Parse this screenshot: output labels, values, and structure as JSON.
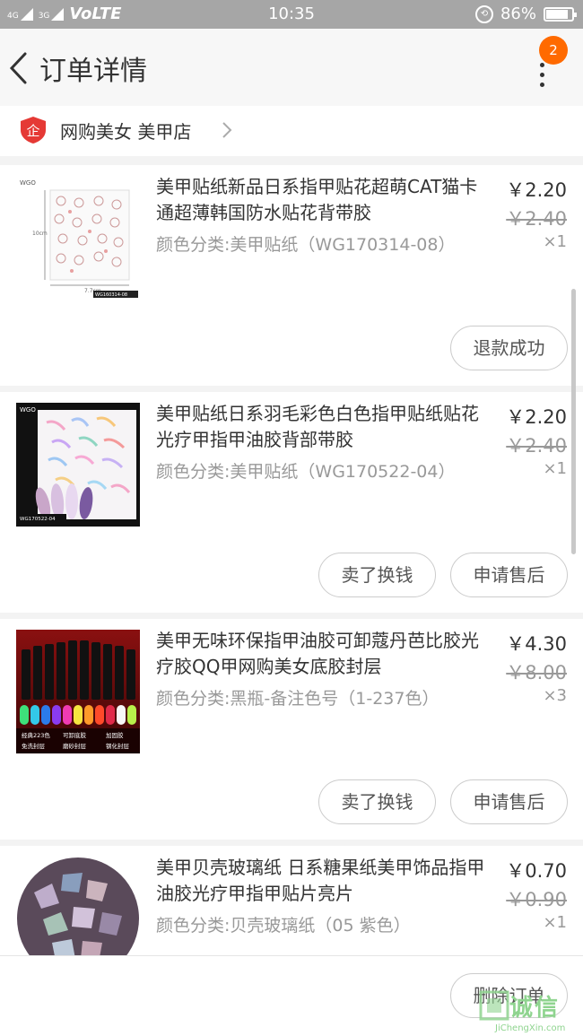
{
  "status_bar": {
    "signal1": "4G",
    "signal2": "3G",
    "network": "VoLTE",
    "time": "10:35",
    "battery": "86%",
    "battery_level": 0.86
  },
  "header": {
    "title": "订单详情",
    "badge_count": "2"
  },
  "shop": {
    "name": "网购美女 美甲店",
    "icon_label": "企"
  },
  "items": [
    {
      "title": "美甲贴纸新品日系指甲贴花超萌CAT猫卡通超薄韩国防水贴花背带胶",
      "sku": "颜色分类:美甲贴纸（WG170314-08）",
      "price": "￥2.20",
      "orig_price": "￥2.40",
      "qty": "×1",
      "thumb_label": "WG160314-08",
      "thumb_height_label": "10cm",
      "thumb_width_label": "7.7cm",
      "thumb_brand": "WGO",
      "buttons": [
        "退款成功"
      ]
    },
    {
      "title": "美甲贴纸日系羽毛彩色白色指甲贴纸贴花 光疗甲指甲油胶背部带胶",
      "sku": "颜色分类:美甲贴纸（WG170522-04）",
      "price": "￥2.20",
      "orig_price": "￥2.40",
      "qty": "×1",
      "thumb_label": "WG170522-04",
      "thumb_brand": "WGO",
      "buttons": [
        "卖了换钱",
        "申请售后"
      ]
    },
    {
      "title": "美甲无味环保指甲油胶可卸蔻丹芭比胶光疗胶QQ甲网购美女底胶封层",
      "sku": "颜色分类:黑瓶-备注色号（1-237色）",
      "price": "￥4.30",
      "orig_price": "￥8.00",
      "qty": "×3",
      "thumb_tags": [
        "经典223色",
        "可卸底胶",
        "加固胶",
        "免洗封层",
        "磨砂封层",
        "钢化封层"
      ],
      "buttons": [
        "卖了换钱",
        "申请售后"
      ]
    },
    {
      "title": "美甲贝壳玻璃纸 日系糖果纸美甲饰品指甲油胶光疗甲指甲贴片亮片",
      "sku": "颜色分类:贝壳玻璃纸（05 紫色）",
      "price": "￥0.70",
      "orig_price": "￥0.90",
      "qty": "×1",
      "buttons": []
    }
  ],
  "bottom": {
    "delete_button": "删除订单"
  },
  "watermark": {
    "text": "诚信",
    "sub": "JiChengXin.com"
  },
  "colors": {
    "accent": "#ff6a00",
    "shop_icon": "#e53935",
    "status_bar": "#a6a6a6"
  }
}
